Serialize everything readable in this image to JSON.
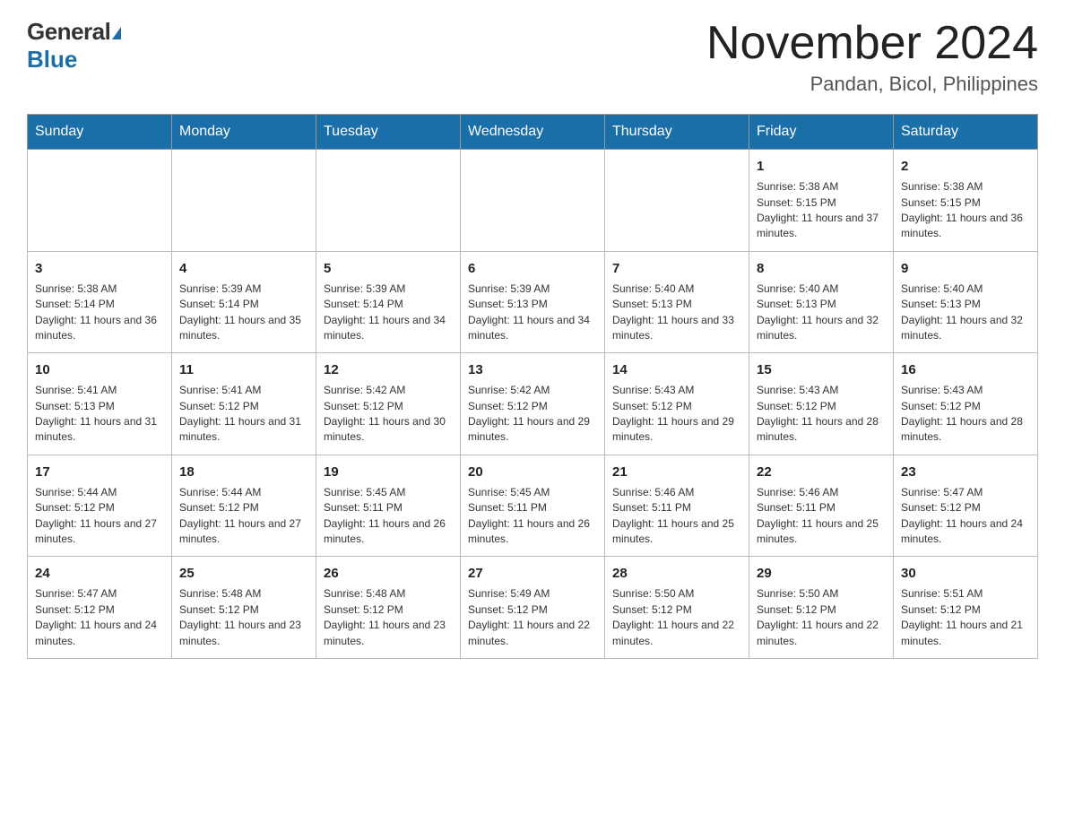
{
  "header": {
    "logo_general": "General",
    "logo_blue": "Blue",
    "month_year": "November 2024",
    "location": "Pandan, Bicol, Philippines"
  },
  "days_of_week": [
    "Sunday",
    "Monday",
    "Tuesday",
    "Wednesday",
    "Thursday",
    "Friday",
    "Saturday"
  ],
  "weeks": [
    [
      {
        "day": "",
        "info": ""
      },
      {
        "day": "",
        "info": ""
      },
      {
        "day": "",
        "info": ""
      },
      {
        "day": "",
        "info": ""
      },
      {
        "day": "",
        "info": ""
      },
      {
        "day": "1",
        "info": "Sunrise: 5:38 AM\nSunset: 5:15 PM\nDaylight: 11 hours and 37 minutes."
      },
      {
        "day": "2",
        "info": "Sunrise: 5:38 AM\nSunset: 5:15 PM\nDaylight: 11 hours and 36 minutes."
      }
    ],
    [
      {
        "day": "3",
        "info": "Sunrise: 5:38 AM\nSunset: 5:14 PM\nDaylight: 11 hours and 36 minutes."
      },
      {
        "day": "4",
        "info": "Sunrise: 5:39 AM\nSunset: 5:14 PM\nDaylight: 11 hours and 35 minutes."
      },
      {
        "day": "5",
        "info": "Sunrise: 5:39 AM\nSunset: 5:14 PM\nDaylight: 11 hours and 34 minutes."
      },
      {
        "day": "6",
        "info": "Sunrise: 5:39 AM\nSunset: 5:13 PM\nDaylight: 11 hours and 34 minutes."
      },
      {
        "day": "7",
        "info": "Sunrise: 5:40 AM\nSunset: 5:13 PM\nDaylight: 11 hours and 33 minutes."
      },
      {
        "day": "8",
        "info": "Sunrise: 5:40 AM\nSunset: 5:13 PM\nDaylight: 11 hours and 32 minutes."
      },
      {
        "day": "9",
        "info": "Sunrise: 5:40 AM\nSunset: 5:13 PM\nDaylight: 11 hours and 32 minutes."
      }
    ],
    [
      {
        "day": "10",
        "info": "Sunrise: 5:41 AM\nSunset: 5:13 PM\nDaylight: 11 hours and 31 minutes."
      },
      {
        "day": "11",
        "info": "Sunrise: 5:41 AM\nSunset: 5:12 PM\nDaylight: 11 hours and 31 minutes."
      },
      {
        "day": "12",
        "info": "Sunrise: 5:42 AM\nSunset: 5:12 PM\nDaylight: 11 hours and 30 minutes."
      },
      {
        "day": "13",
        "info": "Sunrise: 5:42 AM\nSunset: 5:12 PM\nDaylight: 11 hours and 29 minutes."
      },
      {
        "day": "14",
        "info": "Sunrise: 5:43 AM\nSunset: 5:12 PM\nDaylight: 11 hours and 29 minutes."
      },
      {
        "day": "15",
        "info": "Sunrise: 5:43 AM\nSunset: 5:12 PM\nDaylight: 11 hours and 28 minutes."
      },
      {
        "day": "16",
        "info": "Sunrise: 5:43 AM\nSunset: 5:12 PM\nDaylight: 11 hours and 28 minutes."
      }
    ],
    [
      {
        "day": "17",
        "info": "Sunrise: 5:44 AM\nSunset: 5:12 PM\nDaylight: 11 hours and 27 minutes."
      },
      {
        "day": "18",
        "info": "Sunrise: 5:44 AM\nSunset: 5:12 PM\nDaylight: 11 hours and 27 minutes."
      },
      {
        "day": "19",
        "info": "Sunrise: 5:45 AM\nSunset: 5:11 PM\nDaylight: 11 hours and 26 minutes."
      },
      {
        "day": "20",
        "info": "Sunrise: 5:45 AM\nSunset: 5:11 PM\nDaylight: 11 hours and 26 minutes."
      },
      {
        "day": "21",
        "info": "Sunrise: 5:46 AM\nSunset: 5:11 PM\nDaylight: 11 hours and 25 minutes."
      },
      {
        "day": "22",
        "info": "Sunrise: 5:46 AM\nSunset: 5:11 PM\nDaylight: 11 hours and 25 minutes."
      },
      {
        "day": "23",
        "info": "Sunrise: 5:47 AM\nSunset: 5:12 PM\nDaylight: 11 hours and 24 minutes."
      }
    ],
    [
      {
        "day": "24",
        "info": "Sunrise: 5:47 AM\nSunset: 5:12 PM\nDaylight: 11 hours and 24 minutes."
      },
      {
        "day": "25",
        "info": "Sunrise: 5:48 AM\nSunset: 5:12 PM\nDaylight: 11 hours and 23 minutes."
      },
      {
        "day": "26",
        "info": "Sunrise: 5:48 AM\nSunset: 5:12 PM\nDaylight: 11 hours and 23 minutes."
      },
      {
        "day": "27",
        "info": "Sunrise: 5:49 AM\nSunset: 5:12 PM\nDaylight: 11 hours and 22 minutes."
      },
      {
        "day": "28",
        "info": "Sunrise: 5:50 AM\nSunset: 5:12 PM\nDaylight: 11 hours and 22 minutes."
      },
      {
        "day": "29",
        "info": "Sunrise: 5:50 AM\nSunset: 5:12 PM\nDaylight: 11 hours and 22 minutes."
      },
      {
        "day": "30",
        "info": "Sunrise: 5:51 AM\nSunset: 5:12 PM\nDaylight: 11 hours and 21 minutes."
      }
    ]
  ]
}
